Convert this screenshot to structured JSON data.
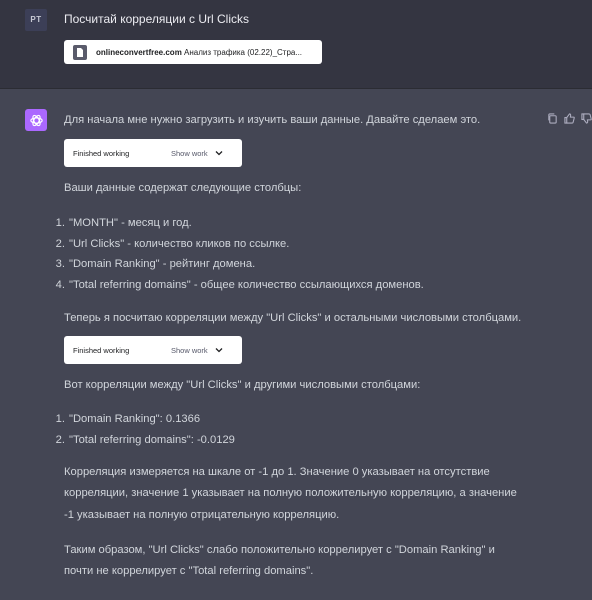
{
  "user_message": {
    "avatar_initials": "PT",
    "text": "Посчитай корреляции с Url Clicks",
    "attachment": {
      "icon": "file-icon",
      "site": "onlineconvertfree.com",
      "name_rest": " Анализ трафика (02.22)_Стра..."
    }
  },
  "assistant_message": {
    "intro": "Для начала мне нужно загрузить и изучить ваши данные. Давайте сделаем это.",
    "work_box_1": {
      "status": "Finished working",
      "show_label": "Show work"
    },
    "columns_intro": "Ваши данные содержат следующие столбцы:",
    "columns": [
      {
        "num": "1.",
        "text": "\"MONTH\" - месяц и год."
      },
      {
        "num": "2.",
        "text": "\"Url Clicks\" - количество кликов по ссылке."
      },
      {
        "num": "3.",
        "text": "\"Domain Ranking\" - рейтинг домена."
      },
      {
        "num": "4.",
        "text": "\"Total referring domains\" - общее количество ссылающихся доменов."
      }
    ],
    "next_step": "Теперь я посчитаю корреляции между \"Url Clicks\" и остальными числовыми столбцами.",
    "work_box_2": {
      "status": "Finished working",
      "show_label": "Show work"
    },
    "corr_intro": "Вот корреляции между \"Url Clicks\" и другими числовыми столбцами:",
    "correlations": [
      {
        "num": "1.",
        "text": "\"Domain Ranking\": 0.1366"
      },
      {
        "num": "2.",
        "text": "\"Total referring domains\": -0.0129"
      }
    ],
    "explanation_lines": [
      "Корреляция измеряется на шкале от -1 до 1. Значение 0 указывает на отсутствие",
      "корреляции, значение 1 указывает на полную положительную корреляцию, а значение",
      "-1 указывает на полную отрицательную корреляцию."
    ],
    "conclusion_lines": [
      "Таким образом, \"Url Clicks\" слабо положительно коррелирует с \"Domain Ranking\" и",
      "почти не коррелирует с \"Total referring domains\"."
    ]
  },
  "icons": {
    "assistant_avatar": "openai-logo-icon",
    "copy": "copy-icon",
    "thumbs_up": "thumbs-up-icon",
    "thumbs_down": "thumbs-down-icon",
    "chevron": "chevron-down-icon"
  },
  "colors": {
    "user_bg": "#343541",
    "assistant_bg": "#444654",
    "avatar_purple": "#ab68ff"
  }
}
